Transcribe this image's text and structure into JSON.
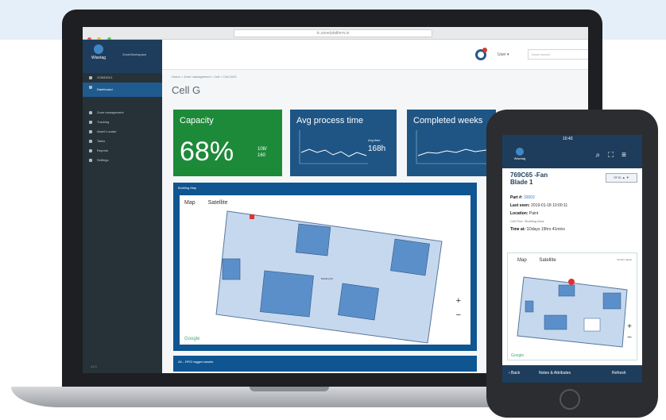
{
  "colors": {
    "sidebar": "#273238",
    "accent": "#1f5b8f",
    "capacity_card": "#1d8a3a",
    "kpi_card": "#1e5585",
    "map_panel": "#0f5591",
    "floor": "#c6d8ee",
    "zone": "#5b8fc9"
  },
  "browser": {
    "url": "tc.zone/platform.io"
  },
  "sidebar": {
    "logo_text": "Wisetag",
    "user": "Zone/Workspace",
    "items": [
      {
        "label": "ZONE/ID/1",
        "icon": "grid-icon"
      },
      {
        "label": "Dashboard",
        "icon": "home-icon",
        "active": true
      },
      {
        "label": "Zone management",
        "icon": "layers-icon"
      },
      {
        "label": "Tracking",
        "icon": "location-icon"
      },
      {
        "label": "Asset Locator",
        "icon": "search-icon"
      },
      {
        "label": "Tasks",
        "icon": "check-icon"
      },
      {
        "label": "Reports",
        "icon": "chart-icon"
      },
      {
        "label": "Settings",
        "icon": "gear-icon"
      }
    ],
    "footer": "v1.0"
  },
  "topnav": {
    "user_menu": "User ▾",
    "search_placeholder": "Asset search"
  },
  "breadcrumb": "Home  >  Zone management  >  Cell  >  Cell G/23",
  "page_title": "Cell G",
  "kpi": {
    "capacity": {
      "label": "Capacity",
      "value": "68%",
      "detail": "108/\n160"
    },
    "avg_process": {
      "label": "Avg process time",
      "side": "Avg time",
      "side_value": "168h"
    },
    "completed": {
      "label": "Completed weeks"
    }
  },
  "map_panel": {
    "title": "Building Map",
    "tab_map": "Map",
    "tab_satellite": "Satellite",
    "zoom_in": "+",
    "zoom_out": "−",
    "google": "Google",
    "building_label": "Building 5A"
  },
  "second_panel": {
    "title": "All – RFID tagged assets"
  },
  "phone": {
    "status_time": "10:43",
    "item_title": "769C65 -Fan\nBlade 1",
    "tag": "RFID ▲ ▼",
    "part_label": "Part #:",
    "part_value": "33002",
    "last_seen_label": "Last seen:",
    "last_seen_value": "2019-01-18 10:00:11",
    "location_label": "Location:",
    "location_value": "Paint",
    "location_sub": "Cell Five / Building Area",
    "time_label": "Time at:",
    "time_value": "1Ddays 19hrs 41mins",
    "map_tab": "Map",
    "satellite_tab": "Satellite",
    "map_extra": "Terrain  Labels",
    "zoom_in": "+",
    "zoom_out": "−",
    "google": "Google",
    "back": "‹ Back",
    "notes": "Notes & Attributes",
    "refresh": "Refresh"
  }
}
